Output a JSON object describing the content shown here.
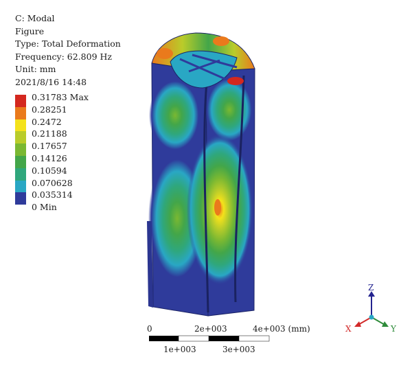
{
  "header": {
    "line1": "C: Modal",
    "line2": "Figure",
    "line3": "Type: Total Deformation",
    "line4": "Frequency: 62.809 Hz",
    "line5": "Unit: mm",
    "line6": "2021/8/16 14:48"
  },
  "legend": {
    "items": [
      {
        "label": "0.31783 Max",
        "color": "#d4281f"
      },
      {
        "label": "0.28251",
        "color": "#ea7a1c"
      },
      {
        "label": "0.2472",
        "color": "#f4e21b"
      },
      {
        "label": "0.21188",
        "color": "#b9cc2a"
      },
      {
        "label": "0.17657",
        "color": "#7ab832"
      },
      {
        "label": "0.14126",
        "color": "#43a649"
      },
      {
        "label": "0.10594",
        "color": "#2fa77c"
      },
      {
        "label": "0.070628",
        "color": "#29a7c4"
      },
      {
        "label": "0.035314",
        "color": "#2f3b9b"
      },
      {
        "label": "0 Min",
        "color": ""
      }
    ]
  },
  "scale": {
    "label_0": "0",
    "label_1": "1e+003",
    "label_2": "2e+003",
    "label_3": "3e+003",
    "label_4": "4e+003 (mm)"
  },
  "triad": {
    "x": "X",
    "y": "Y",
    "z": "Z",
    "x_color": "#d22a2a",
    "y_color": "#2e8b3a",
    "z_color": "#23238f"
  }
}
